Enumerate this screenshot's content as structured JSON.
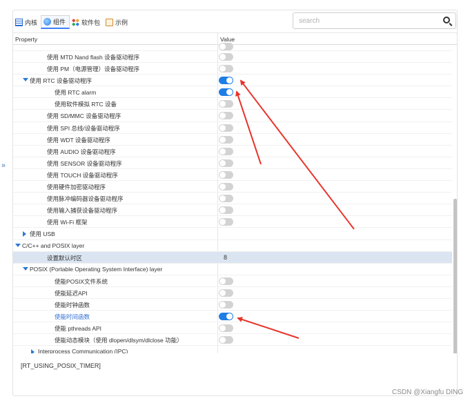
{
  "toolbar": {
    "tabs": [
      {
        "label": "内核",
        "icon": "kernel-icon"
      },
      {
        "label": "组件",
        "icon": "component-icon",
        "active": true
      },
      {
        "label": "软件包",
        "icon": "package-icon"
      },
      {
        "label": "示例",
        "icon": "example-icon"
      }
    ]
  },
  "search": {
    "placeholder": "search",
    "value": ""
  },
  "grid": {
    "col_property": "Property",
    "col_value": "Value",
    "rows": [
      {
        "label": "",
        "indent": 2,
        "control": "toggle",
        "on": false,
        "partial": true
      },
      {
        "label": "使用 MTD Nand flash 设备驱动程序",
        "indent": 2,
        "control": "toggle",
        "on": false
      },
      {
        "label": "使用 PM（电源管理）设备驱动程序",
        "indent": 2,
        "control": "toggle",
        "on": false
      },
      {
        "label": "使用 RTC 设备驱动程序",
        "indent": 1,
        "expander": "down",
        "control": "toggle",
        "on": true
      },
      {
        "label": "使用 RTC alarm",
        "indent": 3,
        "control": "toggle",
        "on": true
      },
      {
        "label": "使用软件模拟 RTC 设备",
        "indent": 3,
        "control": "toggle",
        "on": false
      },
      {
        "label": "使用 SD/MMC 设备驱动程序",
        "indent": 2,
        "control": "toggle",
        "on": false
      },
      {
        "label": "使用 SPI 总线/设备驱动程序",
        "indent": 2,
        "control": "toggle",
        "on": false
      },
      {
        "label": "使用 WDT 设备驱动程序",
        "indent": 2,
        "control": "toggle",
        "on": false
      },
      {
        "label": "使用 AUDIO 设备驱动程序",
        "indent": 2,
        "control": "toggle",
        "on": false
      },
      {
        "label": "使用 SENSOR 设备驱动程序",
        "indent": 2,
        "control": "toggle",
        "on": false
      },
      {
        "label": "使用 TOUCH 设备驱动程序",
        "indent": 2,
        "control": "toggle",
        "on": false
      },
      {
        "label": "使用硬件加密驱动程序",
        "indent": 2,
        "control": "toggle",
        "on": false
      },
      {
        "label": "使用脉冲编码器设备驱动程序",
        "indent": 2,
        "control": "toggle",
        "on": false
      },
      {
        "label": "使用输入捕获设备驱动程序",
        "indent": 2,
        "control": "toggle",
        "on": false
      },
      {
        "label": "使用 Wi-Fi 框架",
        "indent": 2,
        "control": "toggle",
        "on": false
      },
      {
        "label": "使用 USB",
        "indent": 1,
        "expander": "right",
        "control": "none"
      },
      {
        "label": "C/C++ and POSIX layer",
        "indent": 0,
        "expander": "down",
        "control": "none"
      },
      {
        "label": "设置默认时区",
        "indent": 2,
        "control": "value",
        "value": "8",
        "selected": true
      },
      {
        "label": "POSIX (Portable Operating System Interface) layer",
        "indent": 1,
        "expander": "down",
        "control": "none"
      },
      {
        "label": "使能POSIX文件系统",
        "indent": 3,
        "control": "toggle",
        "on": false
      },
      {
        "label": "使能延迟API",
        "indent": 3,
        "control": "toggle",
        "on": false
      },
      {
        "label": "使能时钟函数",
        "indent": 3,
        "control": "toggle",
        "on": false
      },
      {
        "label": "使能时间函数",
        "indent": 3,
        "control": "toggle",
        "on": true,
        "highlight": true
      },
      {
        "label": "使能 pthreads API",
        "indent": 3,
        "control": "toggle",
        "on": false
      },
      {
        "label": "使能动态模块（使用 dlopen/dlsym/dlclose 功能）",
        "indent": 3,
        "control": "toggle",
        "on": false
      },
      {
        "label": "Interprocess Communication (IPC)",
        "indent": 2,
        "expander": "right",
        "control": "none",
        "partial": true
      }
    ]
  },
  "description": "[RT_USING_POSIX_TIMER]",
  "watermark": "CSDN @Xiangfu DING",
  "colors": {
    "accent": "#1e7ee6",
    "annotation_arrow": "#e8352b",
    "selected_row": "#dbe5f1"
  }
}
